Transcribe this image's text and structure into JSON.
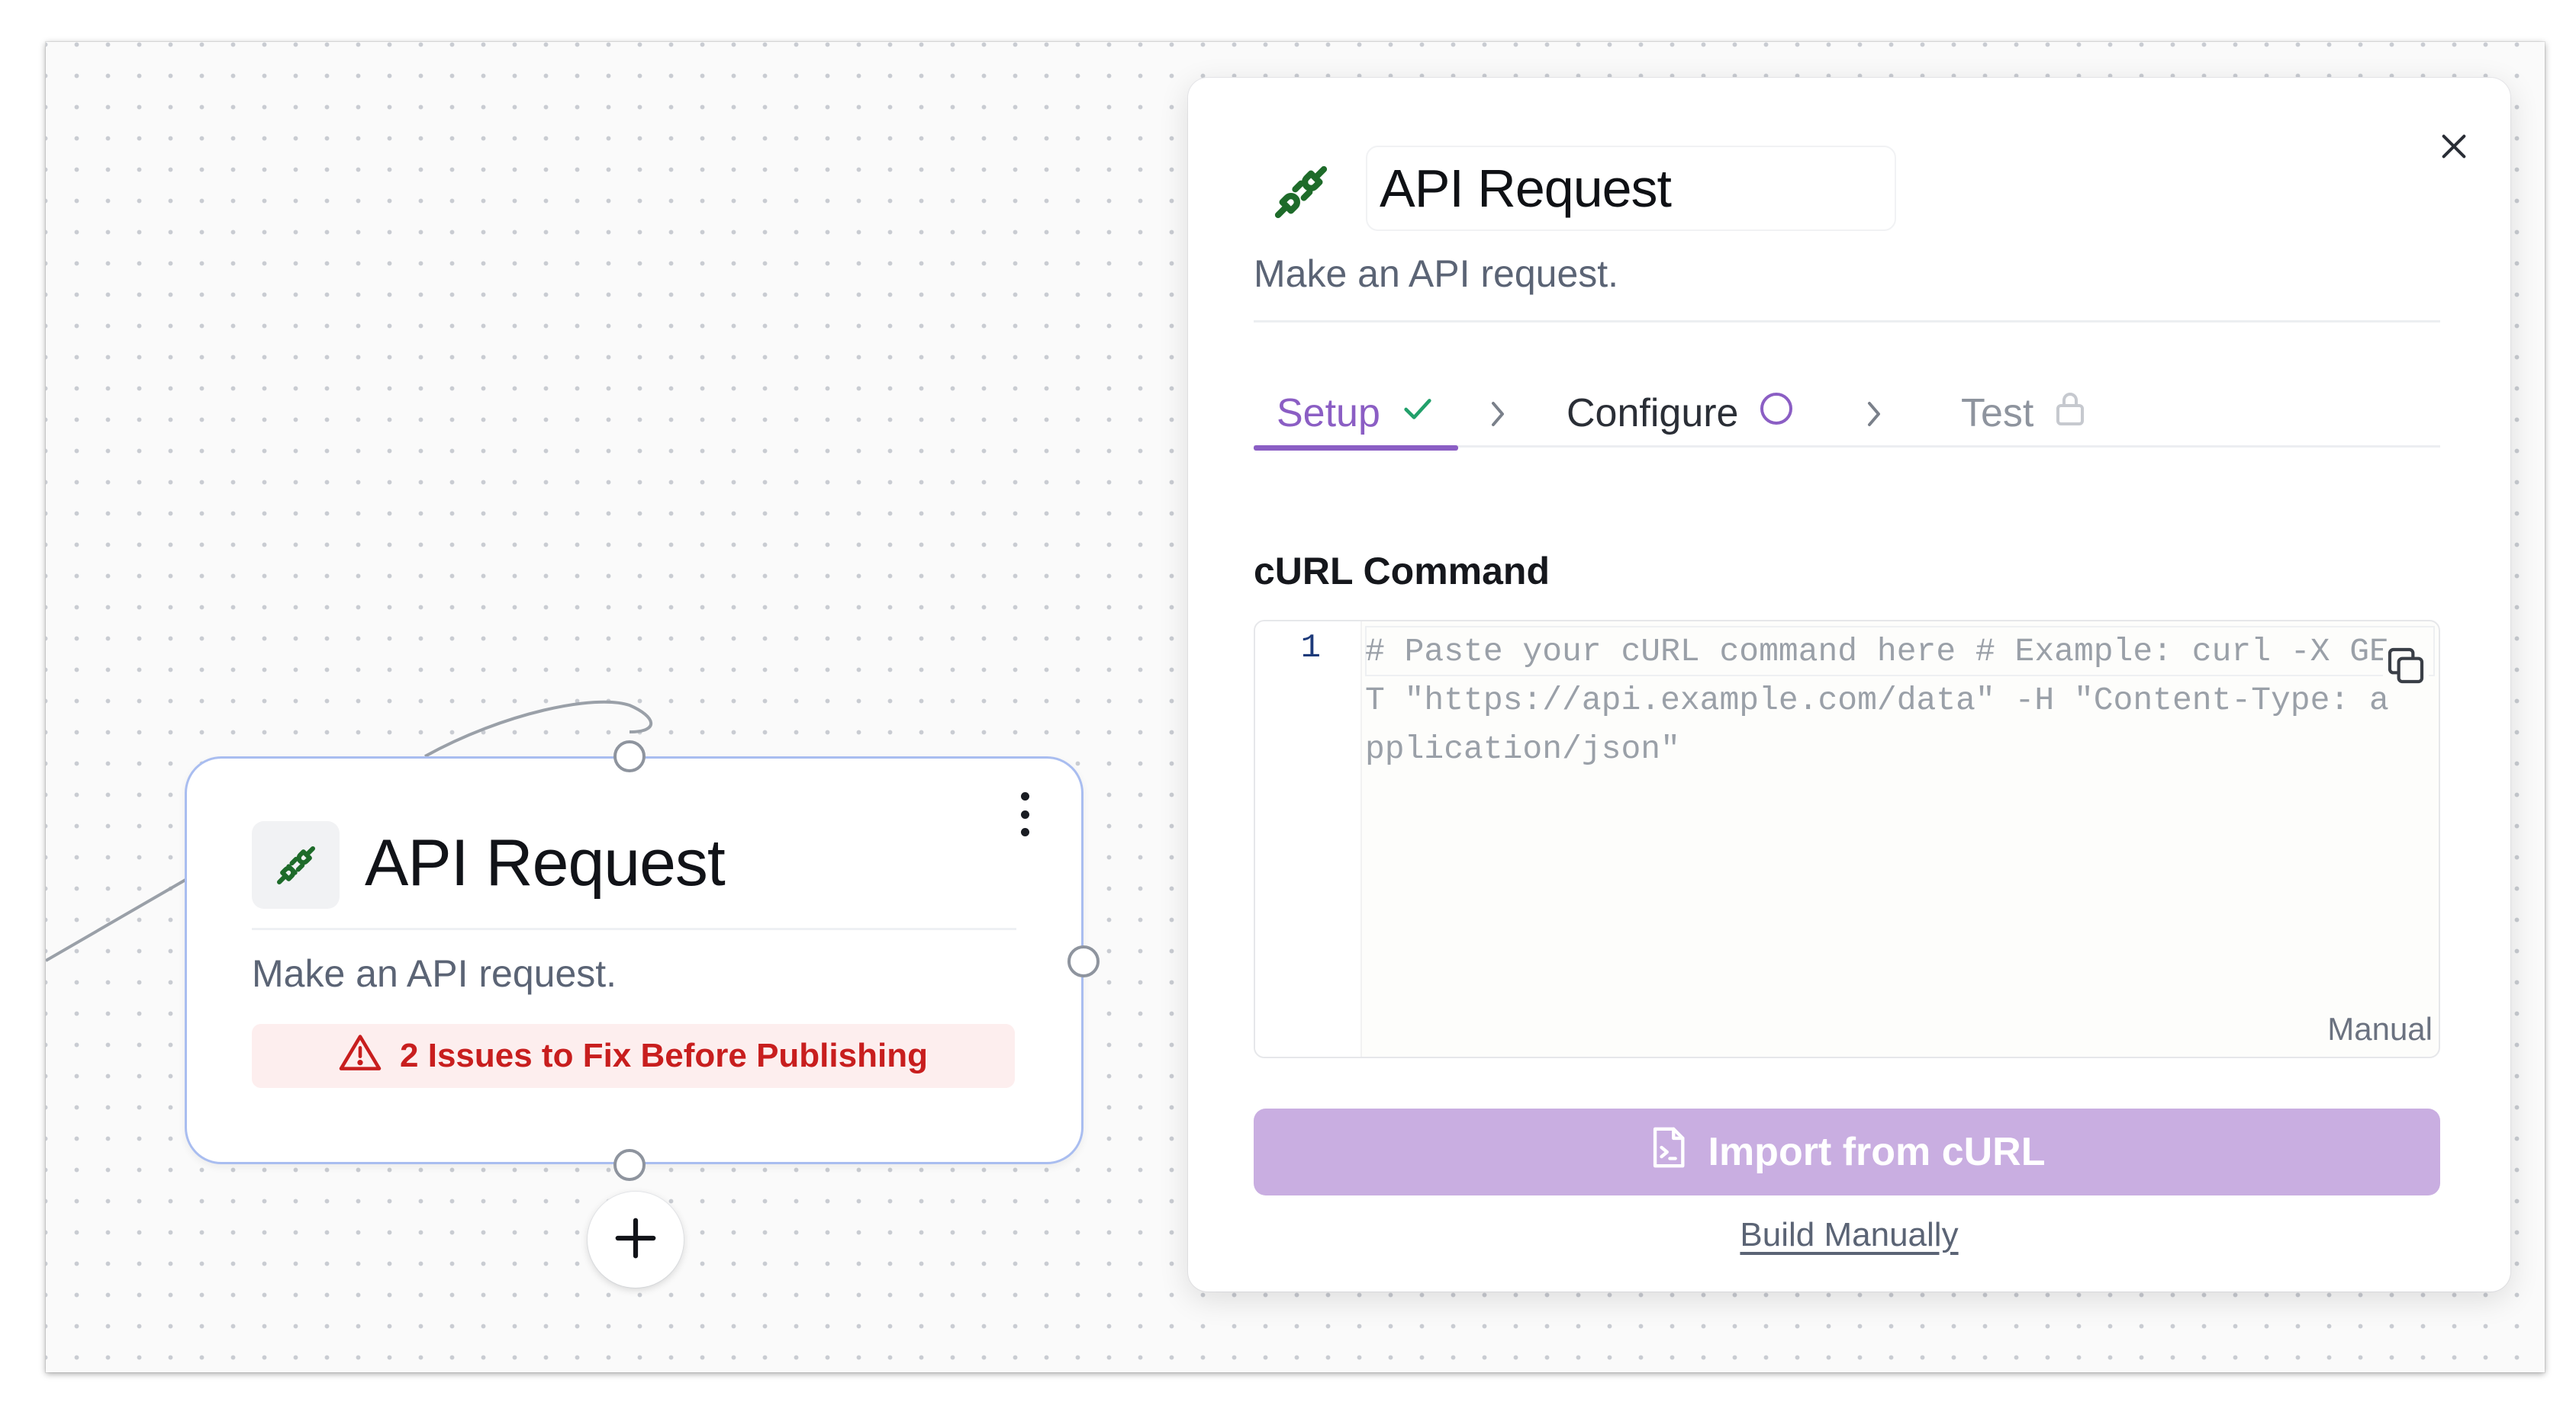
{
  "canvas": {
    "node": {
      "title": "API Request",
      "description": "Make an API request.",
      "warning": "2 Issues to Fix Before Publishing",
      "icon": "plug-icon",
      "menu_icon": "kebab-menu-icon",
      "add_icon": "plus-icon"
    }
  },
  "panel": {
    "title": "API Request",
    "description": "Make an API request.",
    "icon": "plug-icon",
    "close_icon": "close-icon",
    "tabs": [
      {
        "label": "Setup",
        "status": "check-icon",
        "active": true
      },
      {
        "label": "Configure",
        "status": "circle-icon",
        "active": false
      },
      {
        "label": "Test",
        "status": "lock-icon",
        "active": false
      }
    ],
    "curl_label": "cURL Command",
    "editor": {
      "line_number": "1",
      "placeholder": "# Paste your cURL command here # Example: curl -X GET \"https://api.example.com/data\" -H \"Content-Type: application/json\"",
      "mode": "Manual"
    },
    "import_button": "Import from cURL",
    "build_manually": "Build Manually"
  },
  "colors": {
    "accent": "#8b5ec4",
    "import_button_bg": "#c9aee1",
    "warning_text": "#c81e1e",
    "warning_bg": "#fdeeee",
    "success": "#22a06b",
    "icon_green": "#1e6b2a",
    "node_border": "#a9bdf0"
  }
}
